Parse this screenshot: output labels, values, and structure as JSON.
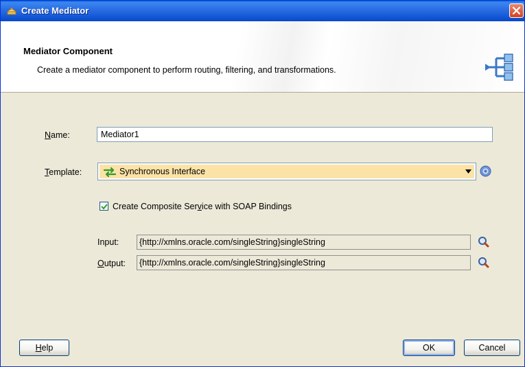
{
  "window": {
    "title": "Create Mediator"
  },
  "header": {
    "title": "Mediator Component",
    "description": "Create a mediator component to perform routing, filtering, and transformations."
  },
  "form": {
    "name_label_key": "N",
    "name_label_rest": "ame:",
    "name_value": "Mediator1",
    "template_label_key": "T",
    "template_label_rest": "emplate:",
    "template_value": "Synchronous Interface",
    "checkbox_label_pre": "Create Composite Ser",
    "checkbox_label_key": "v",
    "checkbox_label_post": "ice with SOAP Bindings",
    "checkbox_checked": true,
    "input_label": "Input:",
    "input_value": "{http://xmlns.oracle.com/singleString}singleString",
    "output_label_key": "O",
    "output_label_rest": "utput:",
    "output_value": "{http://xmlns.oracle.com/singleString}singleString"
  },
  "buttons": {
    "help_key": "H",
    "help_rest": "elp",
    "ok": "OK",
    "cancel": "Cancel"
  },
  "icons": {
    "title": "mediator-icon",
    "header": "mediator-component-icon",
    "template": "sync-arrows-icon",
    "help": "help-icon",
    "input_browse": "search-icon",
    "output_browse": "search-icon"
  }
}
